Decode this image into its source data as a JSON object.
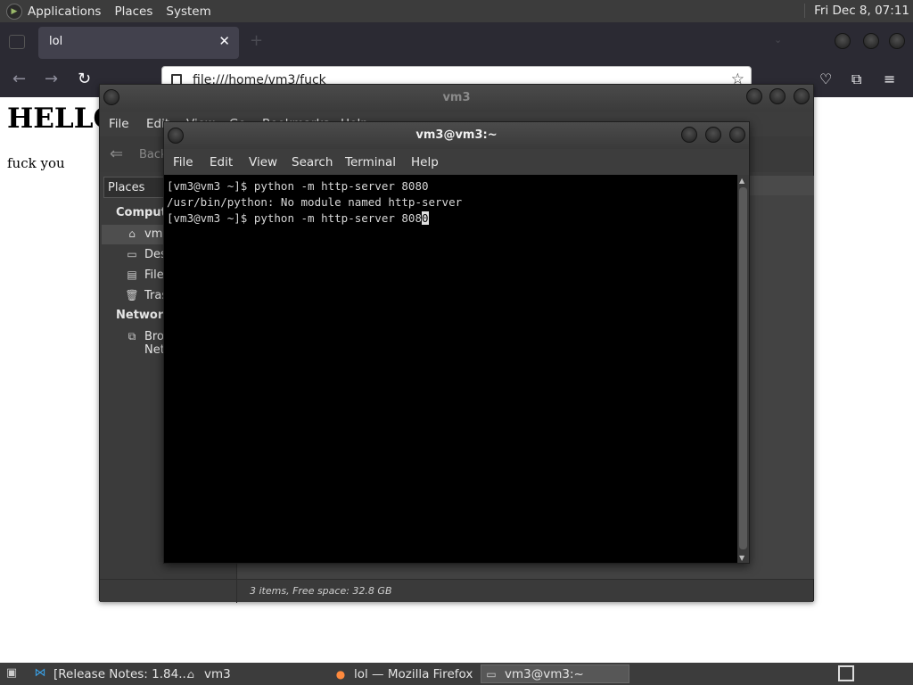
{
  "top_panel": {
    "menus": [
      "Applications",
      "Places",
      "System"
    ],
    "clock": "Fri Dec  8, 07:11"
  },
  "firefox": {
    "tab_title": "lol",
    "tab_close": "✕",
    "new_tab": "+",
    "url": "file:///home/vm3/fuck",
    "page": {
      "heading": "HELLO",
      "body": "fuck you"
    }
  },
  "file_manager": {
    "title": "vm3",
    "menus": [
      "File",
      "Edit",
      "View",
      "Go",
      "Bookmarks",
      "Help"
    ],
    "back_label": "Back",
    "places_label": "Places",
    "sections": {
      "computer": "Computer",
      "network": "Network"
    },
    "items": [
      {
        "label": "vm3",
        "icon": "home-icon"
      },
      {
        "label": "Desktop",
        "icon": "desktop-icon"
      },
      {
        "label": "File System",
        "icon": "drive-icon"
      },
      {
        "label": "Trash",
        "icon": "trash-icon"
      },
      {
        "label": "Browse Network",
        "icon": "network-icon"
      }
    ],
    "status": "3 items, Free space: 32.8 GB"
  },
  "terminal": {
    "title": "vm3@vm3:~",
    "menus": [
      "File",
      "Edit",
      "View",
      "Search",
      "Terminal",
      "Help"
    ],
    "lines": [
      "[vm3@vm3 ~]$ python -m http-server 8080",
      "/usr/bin/python: No module named http-server",
      "[vm3@vm3 ~]$ python -m http-server 808"
    ],
    "cursor_char": "0"
  },
  "taskbar": {
    "tasks": [
      {
        "label": "[Release Notes: 1.84...",
        "icon": "vscode-icon"
      },
      {
        "label": "vm3",
        "icon": "folder-home-icon"
      },
      {
        "label": "lol — Mozilla Firefox",
        "icon": "firefox-icon"
      },
      {
        "label": "vm3@vm3:~",
        "icon": "terminal-icon"
      }
    ]
  },
  "colors": {
    "panel": "#3c3c3c",
    "firefox_chrome": "#2b2a33",
    "terminal_bg": "#000000",
    "terminal_fg": "#d7d7d7"
  }
}
